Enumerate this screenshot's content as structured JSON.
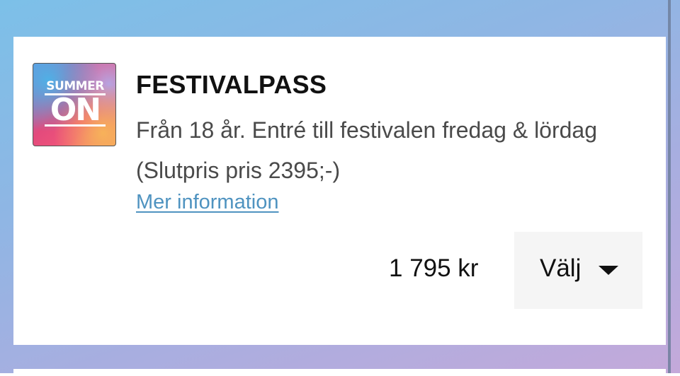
{
  "product": {
    "logo": {
      "top_text": "SUMMER",
      "main_text": "ON",
      "icon": "summer-on-logo"
    },
    "title": "FESTIVALPASS",
    "description": "Från 18 år. Entré till festivalen fredag & lördag (Slutpris pris 2395;-)",
    "more_info_label": "Mer information",
    "price": "1 795 kr",
    "select_label": "Välj",
    "select_icon": "caret-down-icon"
  },
  "colors": {
    "link": "#4f93c0",
    "card_background": "#ffffff",
    "button_background": "#f5f5f5"
  }
}
